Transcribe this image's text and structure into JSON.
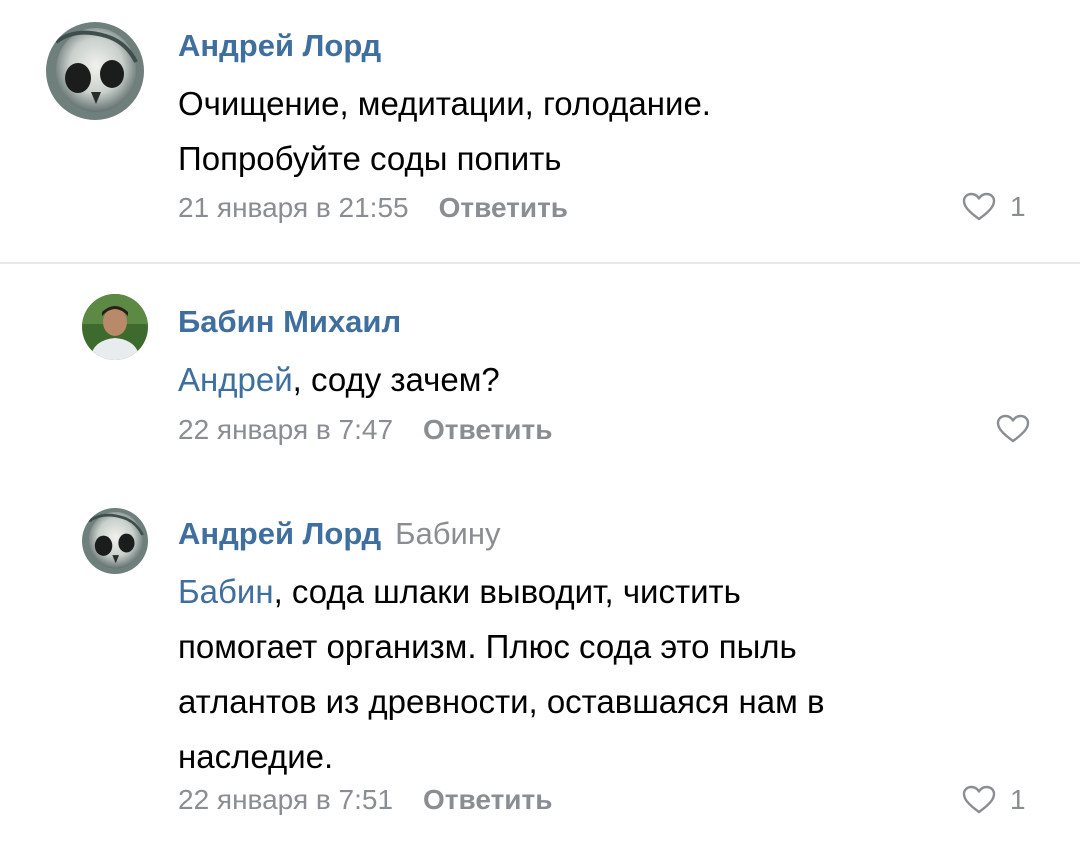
{
  "comments": [
    {
      "author": "Андрей Лорд",
      "reply_to": "",
      "mention": "",
      "text_lines": [
        "Очищение, медитации, голодание.",
        "Попробуйте соды попить"
      ],
      "date": "21 января в 21:55",
      "reply_label": "Ответить",
      "likes": "1",
      "avatar_icon": "skull-avatar"
    },
    {
      "author": "Бабин Михаил",
      "reply_to": "",
      "mention": "Андрей",
      "text_lines": [
        ", соду зачем?"
      ],
      "date": "22 января в 7:47",
      "reply_label": "Ответить",
      "likes": "",
      "avatar_icon": "person-avatar"
    },
    {
      "author": "Андрей Лорд",
      "reply_to": "Бабину",
      "mention": "Бабин",
      "text_lines": [
        ", сода шлаки выводит, чистить",
        "помогает организм. Плюс сода это пыль",
        "атлантов из древности, оставшаяся нам в",
        "наследие."
      ],
      "date": "22 января в 7:51",
      "reply_label": "Ответить",
      "likes": "1",
      "avatar_icon": "skull-avatar"
    }
  ],
  "colors": {
    "link": "#3f6f9f",
    "muted": "#8a8d91",
    "divider": "#e7e8ec"
  }
}
